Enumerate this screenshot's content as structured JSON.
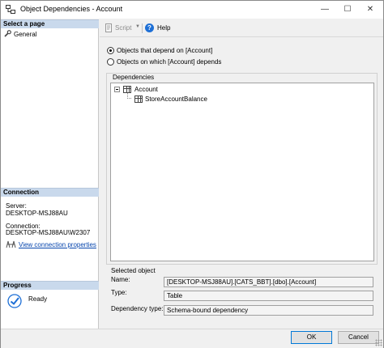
{
  "window": {
    "title": "Object Dependencies - Account",
    "minimize_glyph": "—",
    "maximize_glyph": "☐",
    "close_glyph": "✕"
  },
  "left_panel": {
    "select_page_header": "Select a page",
    "pages": [
      {
        "label": "General",
        "icon": "wrench-icon"
      }
    ],
    "connection_header": "Connection",
    "server_label": "Server:",
    "server_value": "DESKTOP-MSJ88AU",
    "connection_label": "Connection:",
    "connection_value": "DESKTOP-MSJ88AU\\W2307",
    "view_connection_link": "View connection properties",
    "progress_header": "Progress",
    "progress_status": "Ready"
  },
  "toolbar": {
    "script_label": "Script",
    "help_label": "Help"
  },
  "options": {
    "depend_on": "Objects that depend on [Account]",
    "depends": "Objects on which [Account] depends",
    "selected": "depend_on"
  },
  "dependencies": {
    "title": "Dependencies",
    "root": "Account",
    "children": [
      "StoreAccountBalance"
    ]
  },
  "selected_object": {
    "title": "Selected object",
    "name_label": "Name:",
    "name_value": "[DESKTOP-MSJ88AU].[CATS_BBT].[dbo].[Account]",
    "type_label": "Type:",
    "type_value": "Table",
    "dependency_type_label": "Dependency type:",
    "dependency_type_value": "Schema-bound dependency"
  },
  "buttons": {
    "ok": "OK",
    "cancel": "Cancel"
  }
}
